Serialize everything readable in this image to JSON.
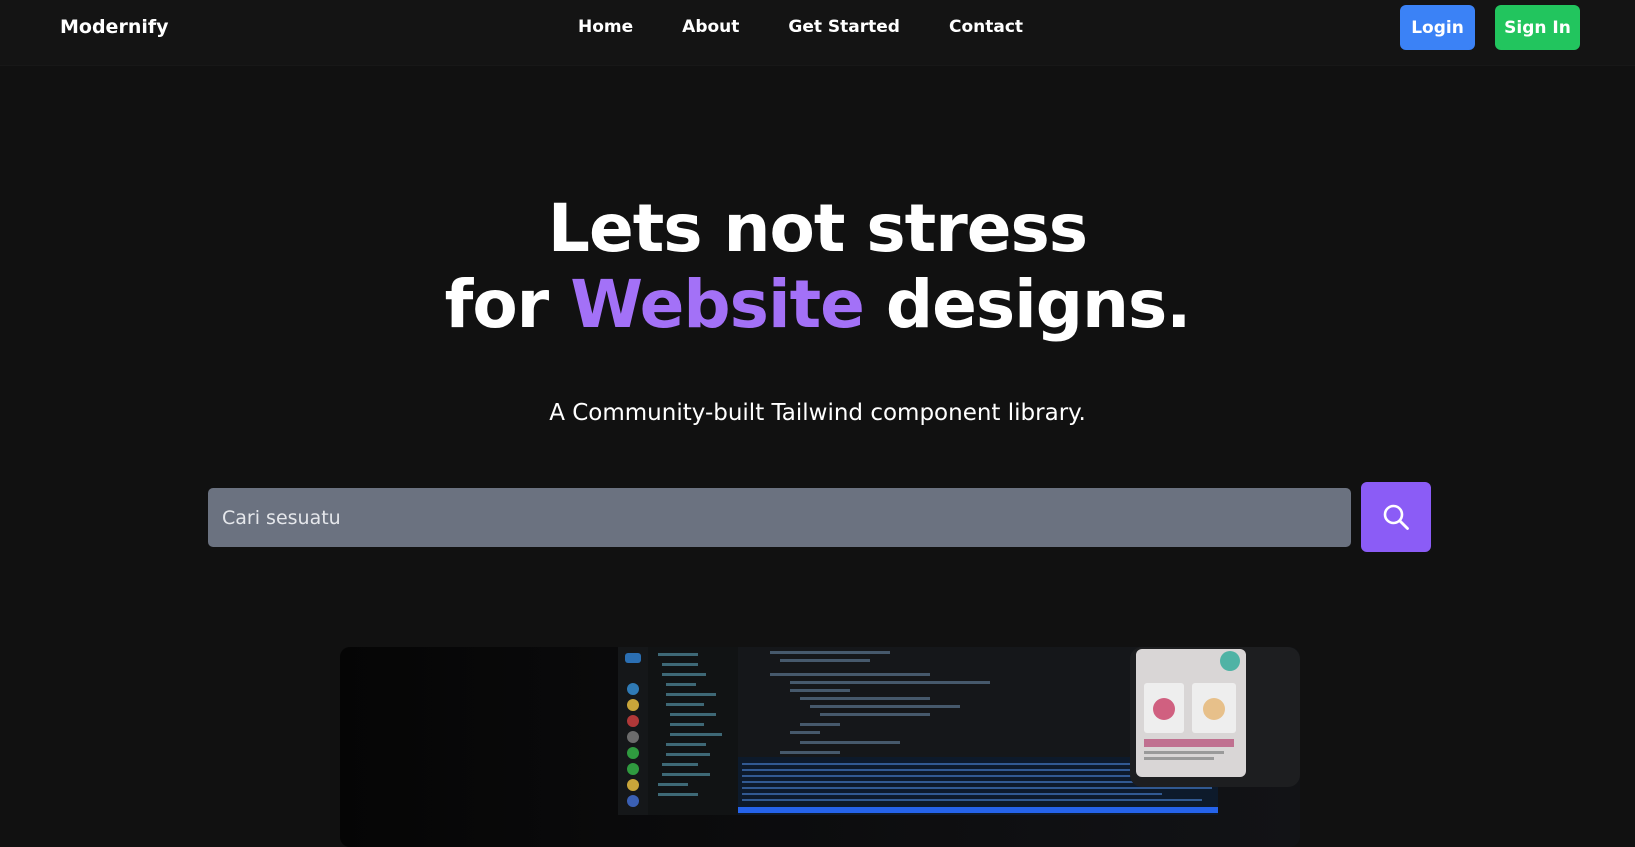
{
  "brand": "Modernify",
  "nav": {
    "links": [
      "Home",
      "About",
      "Get Started",
      "Contact"
    ],
    "login_label": "Login",
    "signin_label": "Sign In"
  },
  "hero": {
    "line1": "Lets not stress",
    "line2_prefix": "for",
    "line2_accent": "Website",
    "line2_suffix": "designs.",
    "subtitle": "A Community-built Tailwind component library."
  },
  "search": {
    "placeholder": "Cari sesuatu",
    "value": "",
    "icon": "search-icon"
  },
  "preview": {
    "image": "code-editor-and-phone-screenshot"
  },
  "colors": {
    "background": "#111111",
    "accent": "#a371f7",
    "login": "#3b82f6",
    "signin": "#22c55e",
    "search_button": "#8b5cf6",
    "search_field": "#6b7280"
  }
}
